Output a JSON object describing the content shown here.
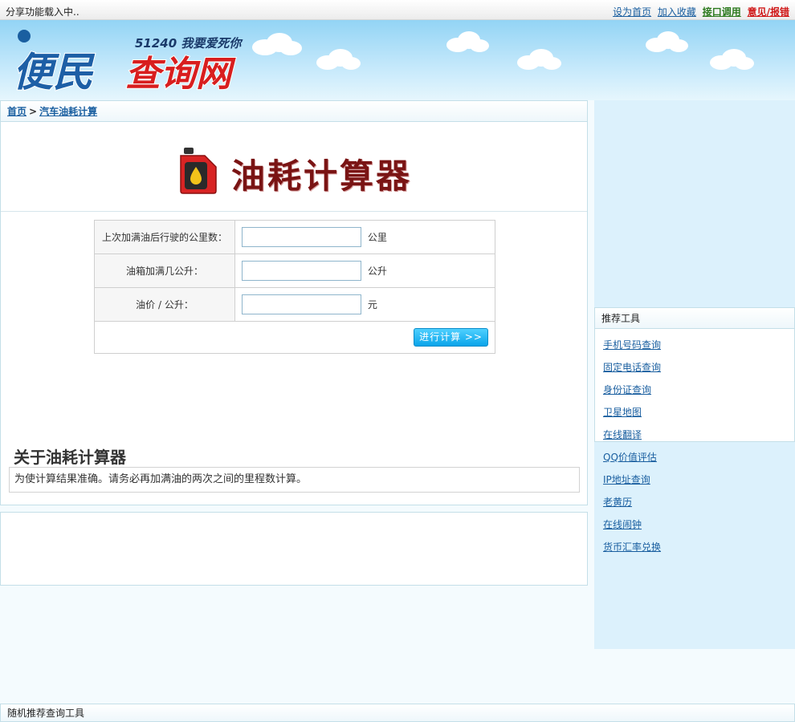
{
  "topbar": {
    "loading": "分享功能载入中..",
    "links": {
      "home": "设为首页",
      "fav": "加入收藏",
      "api": "接口调用",
      "report": "意见/报错"
    }
  },
  "header": {
    "logo_slogan": "51240 我要爱死你",
    "logo_text_1": "便民",
    "logo_text_2": "查询网"
  },
  "breadcrumb": {
    "home": "首页",
    "sep": ">",
    "current": "汽车油耗计算"
  },
  "banner": {
    "title": "油耗计算器"
  },
  "form": {
    "rows": [
      {
        "label": "上次加满油后行驶的公里数：",
        "value": "",
        "unit": "公里"
      },
      {
        "label": "油箱加满几公升：",
        "value": "",
        "unit": "公升"
      },
      {
        "label": "油价 / 公升：",
        "value": "",
        "unit": "元"
      }
    ],
    "submit": "进行计算 >>"
  },
  "about": {
    "heading": "关于油耗计算器",
    "text": "为使计算结果准确。请务必再加满油的两次之间的里程数计算。"
  },
  "tools": {
    "title": "推荐工具",
    "items": [
      "手机号码查询",
      "固定电话查询",
      "身份证查询",
      "卫星地图",
      "在线翻译",
      "QQ价值评估",
      "IP地址查询",
      "老黄历",
      "在线闹钟",
      "货币汇率兑换"
    ]
  },
  "random": {
    "title": "随机推荐查询工具"
  },
  "colors": {
    "accent": "#1a5fa0",
    "title_red": "#7a1414",
    "green_link": "#2c7a1e",
    "red_link": "#d01818",
    "button": "#0aa4ea"
  }
}
